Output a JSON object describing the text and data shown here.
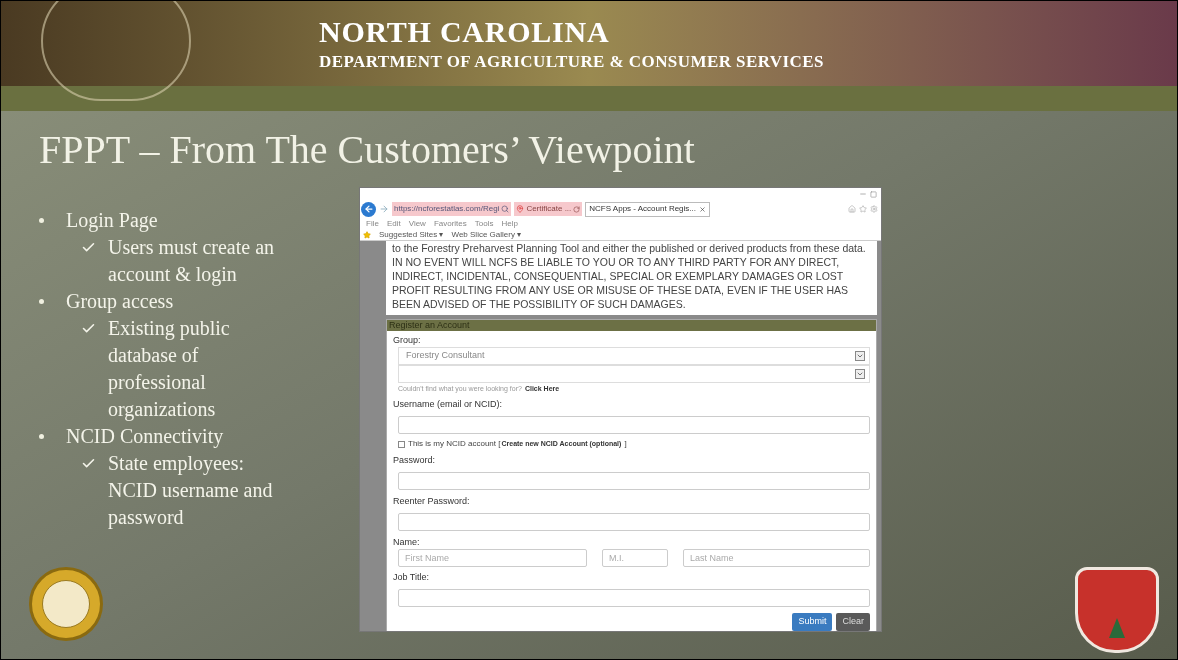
{
  "header": {
    "title": "NORTH CAROLINA",
    "subtitle": "DEPARTMENT OF AGRICULTURE & CONSUMER SERVICES"
  },
  "slide_title": "FPPT – From The Customers’ Viewpoint",
  "bullets": [
    {
      "text": "Login Page",
      "children": [
        {
          "text": "Users must create an account & login"
        }
      ]
    },
    {
      "text": "Group access",
      "children": [
        {
          "text": "Existing public database of professional organizations"
        }
      ]
    },
    {
      "text": "NCID Connectivity",
      "children": [
        {
          "text": "State employees: NCID username and password"
        }
      ]
    }
  ],
  "browser": {
    "address": "https://ncforestatlas.com/Regi",
    "certificate": "Certificate ...",
    "tabs": [
      {
        "label": "NCFS Apps - Account Regis...",
        "selected": true
      }
    ],
    "menu": [
      "File",
      "Edit",
      "View",
      "Favorites",
      "Tools",
      "Help"
    ],
    "favorites": [
      "Suggested Sites ▾",
      "Web Slice Gallery ▾"
    ],
    "disclaimer": "to the Forestry Preharvest Planning Tool and either the published or derived products from these data. IN NO EVENT WILL NCFS BE LIABLE TO YOU OR TO ANY THIRD PARTY FOR ANY DIRECT, INDIRECT, INCIDENTAL, CONSEQUENTIAL, SPECIAL OR EXEMPLARY DAMAGES OR LOST PROFIT RESULTING FROM ANY USE OR MISUSE OF THESE DATA, EVEN IF THE USER HAS BEEN ADVISED OF THE POSSIBILITY OF SUCH DAMAGES.",
    "form": {
      "heading": "Register an Account",
      "group_label": "Group:",
      "group_value": "Forestry Consultant",
      "help_text": "Couldn't find what you were looking for?",
      "help_link": "Click Here",
      "username_label": "Username (email or NCID):",
      "ncid_checkbox": {
        "label": "This is my NCID account [",
        "link": "Create new NCID Account (optional)",
        "closing": "]",
        "checked": false
      },
      "password_label": "Password:",
      "reenter_label": "Reenter Password:",
      "name_label": "Name:",
      "name_placeholders": [
        "First Name",
        "M.I.",
        "Last Name"
      ],
      "job_label": "Job Title:",
      "buttons": [
        {
          "label": "Submit",
          "kind": "primary"
        },
        {
          "label": "Clear",
          "kind": "secondary"
        }
      ]
    }
  }
}
